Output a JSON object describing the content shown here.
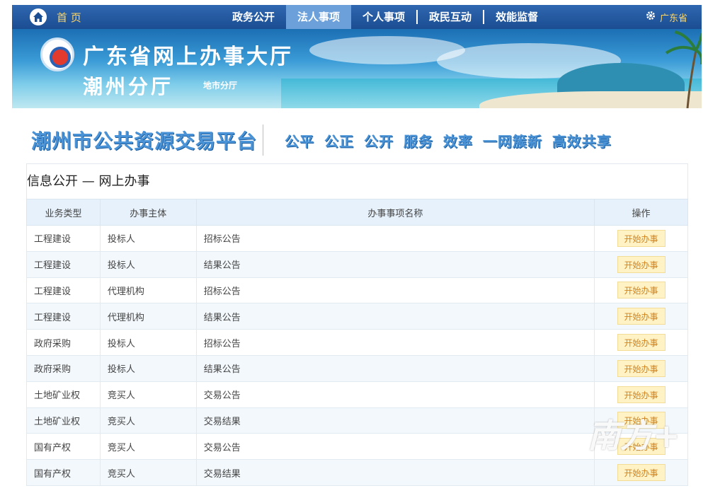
{
  "nav": {
    "home_label": "首 页",
    "items": [
      "政务公开",
      "法人事项",
      "个人事项",
      "政民互动",
      "效能监督"
    ],
    "active_index": 1,
    "region_label": "广东省"
  },
  "banner": {
    "title": "广东省网上办事大厅",
    "subtitle": "潮州分厅",
    "sub_tag": "地市分厅"
  },
  "platform": {
    "name": "潮州市公共资源交易平台",
    "slogan": "公平 公正 公开 服务 效率 一网簇新 高效共享"
  },
  "panel": {
    "title": "信息公开 — 网上办事",
    "columns": [
      "业务类型",
      "办事主体",
      "办事事项名称",
      "操作"
    ],
    "rows": [
      {
        "type": "工程建设",
        "subject": "投标人",
        "item": "招标公告",
        "action": "开始办事"
      },
      {
        "type": "工程建设",
        "subject": "投标人",
        "item": "结果公告",
        "action": "开始办事"
      },
      {
        "type": "工程建设",
        "subject": "代理机构",
        "item": "招标公告",
        "action": "开始办事"
      },
      {
        "type": "工程建设",
        "subject": "代理机构",
        "item": "结果公告",
        "action": "开始办事"
      },
      {
        "type": "政府采购",
        "subject": "投标人",
        "item": "招标公告",
        "action": "开始办事"
      },
      {
        "type": "政府采购",
        "subject": "投标人",
        "item": "结果公告",
        "action": "开始办事"
      },
      {
        "type": "土地矿业权",
        "subject": "竞买人",
        "item": "交易公告",
        "action": "开始办事"
      },
      {
        "type": "土地矿业权",
        "subject": "竞买人",
        "item": "交易结果",
        "action": "开始办事"
      },
      {
        "type": "国有产权",
        "subject": "竞买人",
        "item": "交易公告",
        "action": "开始办事"
      },
      {
        "type": "国有产权",
        "subject": "竞买人",
        "item": "交易结果",
        "action": "开始办事"
      }
    ]
  },
  "watermark": "南方+",
  "colors": {
    "nav_bg": "#1b4d92",
    "nav_active": "#6ba0da",
    "accent": "#4a93d6",
    "button_bg": "#fff3c6",
    "button_text": "#d3821a"
  },
  "icons": {
    "home": "home-icon",
    "settings": "gear-icon"
  }
}
